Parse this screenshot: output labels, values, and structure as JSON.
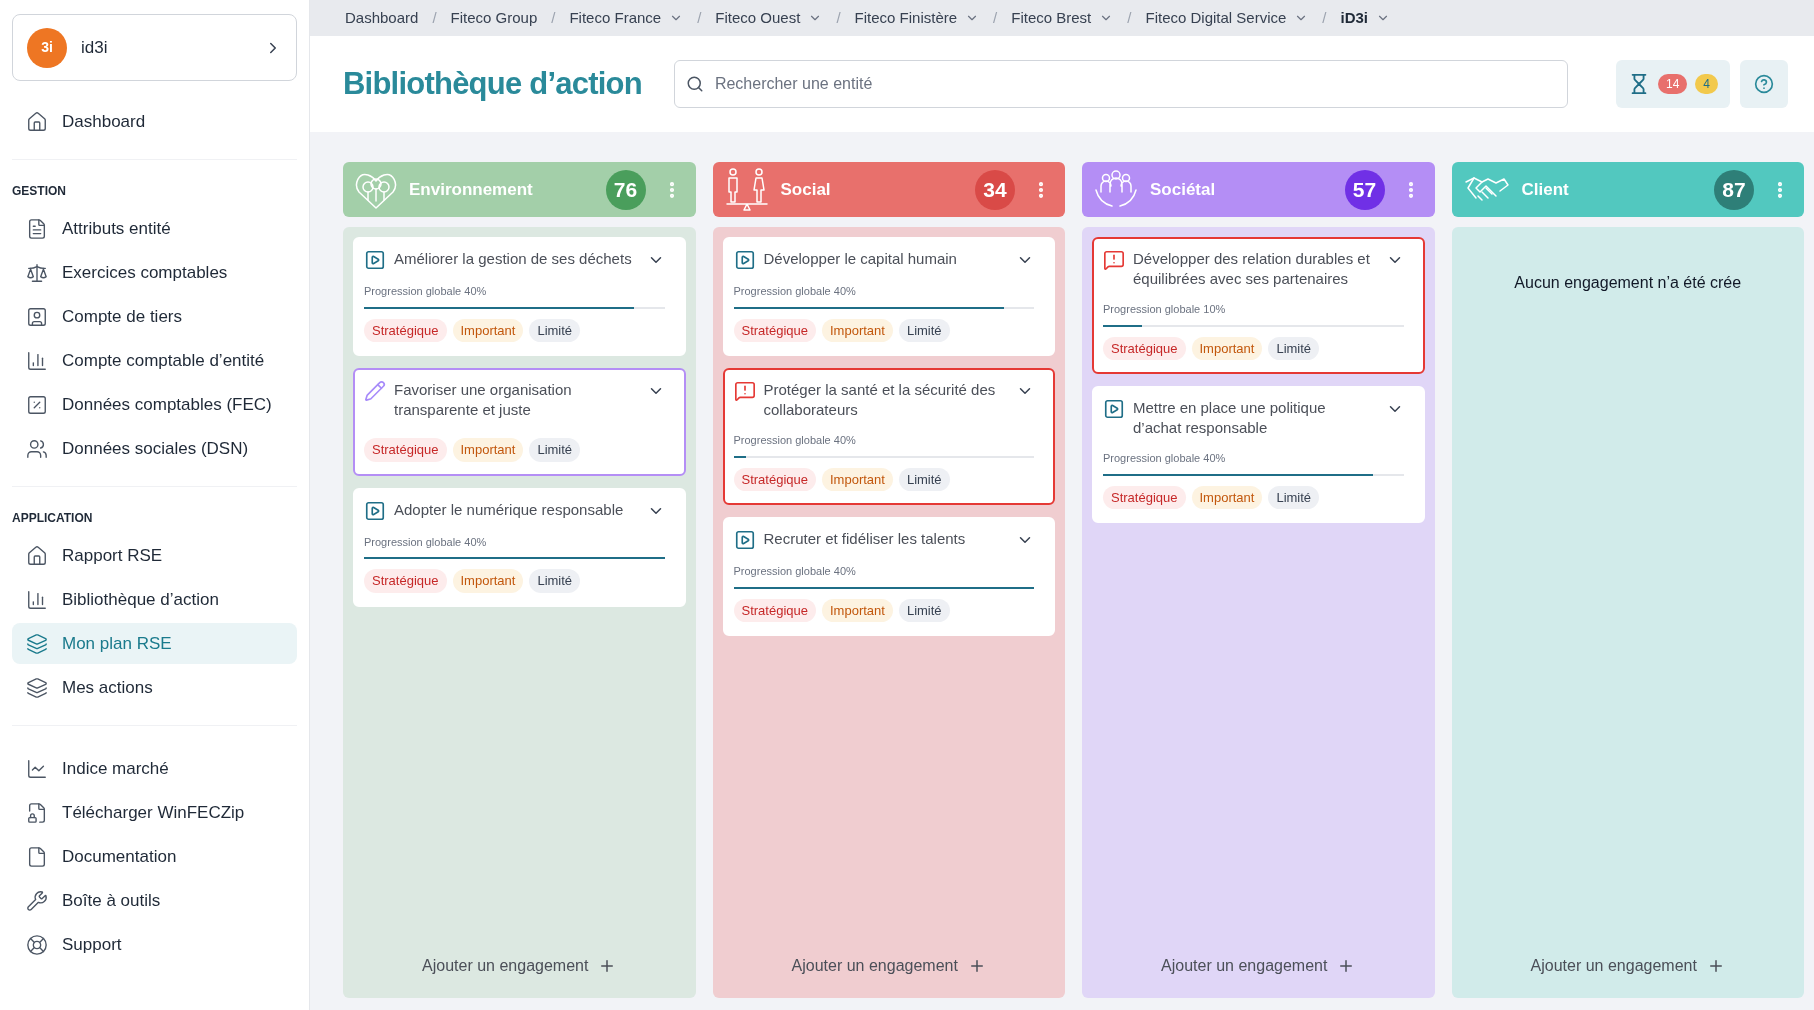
{
  "sidebar": {
    "org": {
      "name": "id3i",
      "logo": "3i"
    },
    "sections": [
      {
        "items": [
          {
            "label": "Dashboard",
            "selected": false
          }
        ]
      },
      {
        "title": "GESTION",
        "items": [
          {
            "label": "Attributs entité",
            "selected": false
          },
          {
            "label": "Exercices comptables",
            "selected": false
          },
          {
            "label": "Compte de tiers",
            "selected": false
          },
          {
            "label": "Compte comptable d’entité",
            "selected": false
          },
          {
            "label": "Données comptables (FEC)",
            "selected": false
          },
          {
            "label": "Données sociales (DSN)",
            "selected": false
          }
        ]
      },
      {
        "title": "APPLICATION",
        "items": [
          {
            "label": "Rapport RSE",
            "selected": false
          },
          {
            "label": "Bibliothèque d’action",
            "selected": false
          },
          {
            "label": "Mon plan RSE",
            "selected": true
          },
          {
            "label": "Mes actions",
            "selected": false
          }
        ]
      },
      {
        "items": [
          {
            "label": "Indice marché",
            "selected": false
          },
          {
            "label": "Télécharger WinFECZip",
            "selected": false
          },
          {
            "label": "Documentation",
            "selected": false
          },
          {
            "label": "Boîte à outils",
            "selected": false
          },
          {
            "label": "Support",
            "selected": false
          }
        ]
      }
    ]
  },
  "breadcrumbs": [
    {
      "label": "Dashboard",
      "dropdown": false,
      "current": false
    },
    {
      "separator": "/",
      "label": "Fiteco Group",
      "dropdown": false,
      "current": false
    },
    {
      "separator": "/",
      "label": "Fiteco France",
      "dropdown": true,
      "current": false
    },
    {
      "separator": "/",
      "label": "Fiteco Ouest",
      "dropdown": true,
      "current": false
    },
    {
      "separator": "/",
      "label": "Fiteco Finistère",
      "dropdown": true,
      "current": false
    },
    {
      "separator": "/",
      "label": "Fiteco Brest",
      "dropdown": true,
      "current": false
    },
    {
      "separator": "/",
      "label": "Fiteco Digital Service",
      "dropdown": true,
      "current": false
    },
    {
      "separator": "/",
      "label": "iD3i",
      "dropdown": true,
      "current": true
    }
  ],
  "header": {
    "title": "Bibliothèque d’action",
    "search": {
      "placeholder": "Rechercher une entité"
    },
    "pending_counts": [
      "14",
      "4"
    ]
  },
  "columns": [
    {
      "kind": "environment",
      "title": "Environnement",
      "count": "76",
      "color": "#a3cfa9",
      "add_label": "Ajouter un engagement",
      "cards": [
        {
          "kind": "active",
          "title": "Améliorer la gestion de ses déchets",
          "progress": "Progression globale 40%",
          "level": 0.9,
          "tags": [
            {
              "kind": "strategic",
              "label": "Stratégique"
            },
            {
              "kind": "important",
              "label": "Important"
            },
            {
              "kind": "limited",
              "label": "Limité"
            }
          ]
        },
        {
          "kind": "draft",
          "title": "Favoriser une organisation transparente et juste",
          "tags": [
            {
              "kind": "strategic",
              "label": "Stratégique"
            },
            {
              "kind": "important",
              "label": "Important"
            },
            {
              "kind": "limited",
              "label": "Limité"
            }
          ]
        },
        {
          "kind": "active",
          "title": "Adopter le numérique responsable",
          "progress": "Progression globale 40%",
          "level": 1,
          "tags": [
            {
              "kind": "strategic",
              "label": "Stratégique"
            },
            {
              "kind": "important",
              "label": "Important"
            },
            {
              "kind": "limited",
              "label": "Limité"
            }
          ]
        }
      ]
    },
    {
      "kind": "social",
      "title": "Social",
      "count": "34",
      "color": "#e8706c",
      "add_label": "Ajouter un engagement",
      "cards": [
        {
          "kind": "active",
          "title": "Développer le capital humain",
          "progress": "Progression globale 40%",
          "level": 0.9,
          "tags": [
            {
              "kind": "strategic",
              "label": "Stratégique"
            },
            {
              "kind": "important",
              "label": "Important"
            },
            {
              "kind": "limited",
              "label": "Limité"
            }
          ]
        },
        {
          "kind": "alert",
          "title": "Protéger la santé et la sécurité des collaborateurs",
          "progress": "Progression globale 40%",
          "level": 0.04,
          "tags": [
            {
              "kind": "strategic",
              "label": "Stratégique"
            },
            {
              "kind": "important",
              "label": "Important"
            },
            {
              "kind": "limited",
              "label": "Limité"
            }
          ]
        },
        {
          "kind": "active",
          "title": "Recruter et fidéliser les talents",
          "progress": "Progression globale 40%",
          "level": 1,
          "tags": [
            {
              "kind": "strategic",
              "label": "Stratégique"
            },
            {
              "kind": "important",
              "label": "Important"
            },
            {
              "kind": "limited",
              "label": "Limité"
            }
          ]
        }
      ]
    },
    {
      "kind": "societal",
      "title": "Sociétal",
      "count": "57",
      "color": "#b48ef5",
      "add_label": "Ajouter un engagement",
      "cards": [
        {
          "kind": "alert",
          "title": "Développer des relation durables et équilibrées avec ses partenaires",
          "progress": "Progression globale 10%",
          "level": 0.13,
          "tags": [
            {
              "kind": "strategic",
              "label": "Stratégique"
            },
            {
              "kind": "important",
              "label": "Important"
            },
            {
              "kind": "limited",
              "label": "Limité"
            }
          ]
        },
        {
          "kind": "active",
          "title": "Mettre en place une politique d’achat responsable",
          "progress": "Progression globale 40%",
          "level": 0.9,
          "tags": [
            {
              "kind": "strategic",
              "label": "Stratégique"
            },
            {
              "kind": "important",
              "label": "Important"
            },
            {
              "kind": "limited",
              "label": "Limité"
            }
          ]
        }
      ]
    },
    {
      "kind": "client",
      "title": "Client",
      "count": "87",
      "color": "#52c8bf",
      "empty_text": "Aucun engagement n’a été crée",
      "add_label": "Ajouter un engagement"
    }
  ]
}
